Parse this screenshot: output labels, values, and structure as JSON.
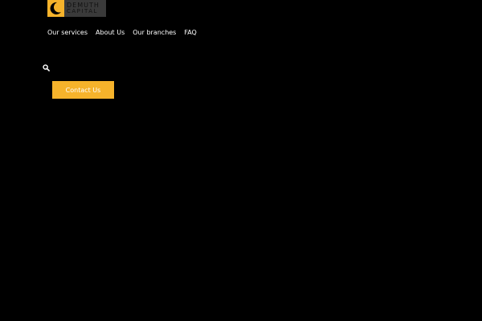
{
  "brand": {
    "line1": "DEMUTH",
    "line2": "CAPITAL",
    "logo_icon": "crescent-logo-icon",
    "accent_color": "#f6b32b"
  },
  "nav": {
    "items": [
      {
        "label": "Our services"
      },
      {
        "label": "About Us"
      },
      {
        "label": "Our branches"
      },
      {
        "label": "FAQ"
      }
    ]
  },
  "search": {
    "icon": "search-icon"
  },
  "cta": {
    "label": "Contact Us"
  }
}
